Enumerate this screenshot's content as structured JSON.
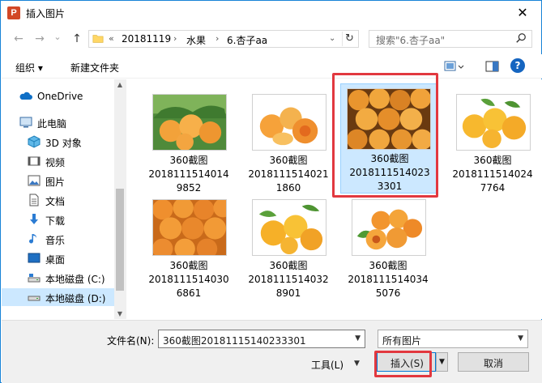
{
  "window": {
    "title": "插入图片",
    "app_icon_letter": "P",
    "close_glyph": "✕"
  },
  "nav": {
    "back_glyph": "←",
    "forward_glyph": "→",
    "dropdown_glyph": "⌄",
    "up_glyph": "↑",
    "breadcrumb_prefix": "«",
    "breadcrumbs": [
      "20181119",
      "水果",
      "6.杏子aa"
    ],
    "crumb_separator": "›",
    "refresh_glyph": "↻",
    "search_placeholder": "搜索\"6.杏子aa\""
  },
  "toolbar": {
    "organize_label": "组织 ▾",
    "new_folder_label": "新建文件夹",
    "help_glyph": "?"
  },
  "sidebar": {
    "items": [
      {
        "label": "OneDrive",
        "icon": "onedrive-icon"
      },
      {
        "label": "此电脑",
        "icon": "this-pc-icon"
      },
      {
        "label": "3D 对象",
        "icon": "3d-objects-icon"
      },
      {
        "label": "视频",
        "icon": "videos-icon"
      },
      {
        "label": "图片",
        "icon": "pictures-icon"
      },
      {
        "label": "文档",
        "icon": "documents-icon"
      },
      {
        "label": "下载",
        "icon": "downloads-icon"
      },
      {
        "label": "音乐",
        "icon": "music-icon"
      },
      {
        "label": "桌面",
        "icon": "desktop-icon"
      },
      {
        "label": "本地磁盘 (C:)",
        "icon": "drive-c-icon"
      },
      {
        "label": "本地磁盘 (D:)",
        "icon": "drive-d-icon"
      }
    ],
    "selected_index": 10
  },
  "files": [
    {
      "line1": "360截图",
      "line2": "2018111514014",
      "line3": "9852"
    },
    {
      "line1": "360截图",
      "line2": "2018111514021",
      "line3": "1860"
    },
    {
      "line1": "360截图",
      "line2": "2018111514023",
      "line3": "3301"
    },
    {
      "line1": "360截图",
      "line2": "2018111514024",
      "line3": "7764"
    },
    {
      "line1": "360截图",
      "line2": "2018111514030",
      "line3": "6861"
    },
    {
      "line1": "360截图",
      "line2": "2018111514032",
      "line3": "8901"
    },
    {
      "line1": "360截图",
      "line2": "2018111514034",
      "line3": "5076"
    }
  ],
  "selected_file_index": 2,
  "bottom": {
    "filename_label": "文件名(N):",
    "filename_value": "360截图20181115140233301",
    "filter_value": "所有图片",
    "tools_label": "工具(L)",
    "insert_label": "插入(S)",
    "cancel_label": "取消"
  },
  "colors": {
    "selection": "#cce8ff",
    "accent": "#0078d7",
    "highlight_red": "#e2383f"
  }
}
